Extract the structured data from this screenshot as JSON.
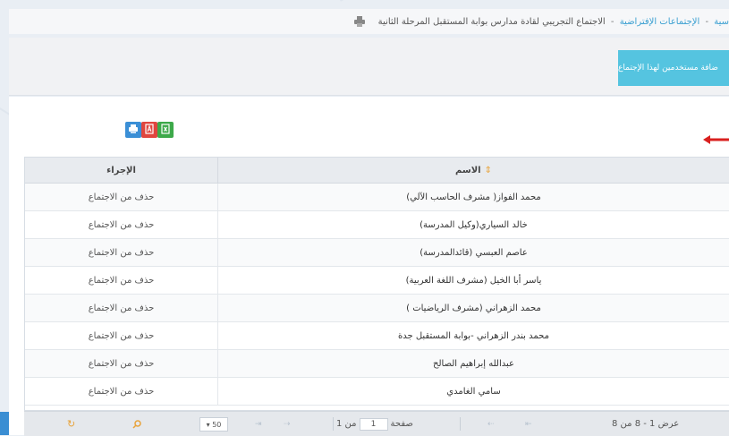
{
  "breadcrumb": {
    "home_fragment": "سية",
    "virtual_meetings": "الإجتماعات الإفتراضية",
    "current": "الاجتماع التجريبي لقادة مدارس بوابة المستقبل المرحلة الثانية",
    "separator": "-"
  },
  "toolbar": {
    "add_users_label": "ضافة مستخدمين لهذا الإجتماع"
  },
  "grid": {
    "columns": {
      "name": "الاسم",
      "action": "الإجراء"
    },
    "rows": [
      {
        "name": "محمد الفواز( مشرف الحاسب الآلي)",
        "action": "حذف من الاجتماع"
      },
      {
        "name": "خالد السياري(وكيل المدرسة)",
        "action": "حذف من الاجتماع"
      },
      {
        "name": "عاصم العبسي (قائدالمدرسة)",
        "action": "حذف من الاجتماع"
      },
      {
        "name": "ياسر أبا الخيل (مشرف اللغة العربية)",
        "action": "حذف من الاجتماع"
      },
      {
        "name": "محمد الزهراني (مشرف الرياضيات )",
        "action": "حذف من الاجتماع"
      },
      {
        "name": "محمد بندر الزهراني -بوابة المستقبل جدة",
        "action": "حذف من الاجتماع"
      },
      {
        "name": "عبدالله إبراهيم الصالح",
        "action": "حذف من الاجتماع"
      },
      {
        "name": "سامي الغامدي",
        "action": "حذف من الاجتماع"
      }
    ]
  },
  "pager": {
    "records": "عرض 1 - 8 من 8",
    "page_label": "صفحة",
    "page_value": "1",
    "of_label": "من 1",
    "page_size": "50"
  },
  "icons": {
    "print": "print-icon",
    "pdf": "pdf-icon",
    "excel": "excel-icon",
    "sort": "sort-icon",
    "search": "search-icon",
    "refresh": "refresh-icon"
  },
  "colors": {
    "link": "#3a9fd1",
    "add_button": "#55c4e0",
    "print": "#3b8fd6",
    "pdf": "#e0463f",
    "excel": "#3da94a",
    "arrow": "#d9201f",
    "accent": "#e8a33a"
  }
}
